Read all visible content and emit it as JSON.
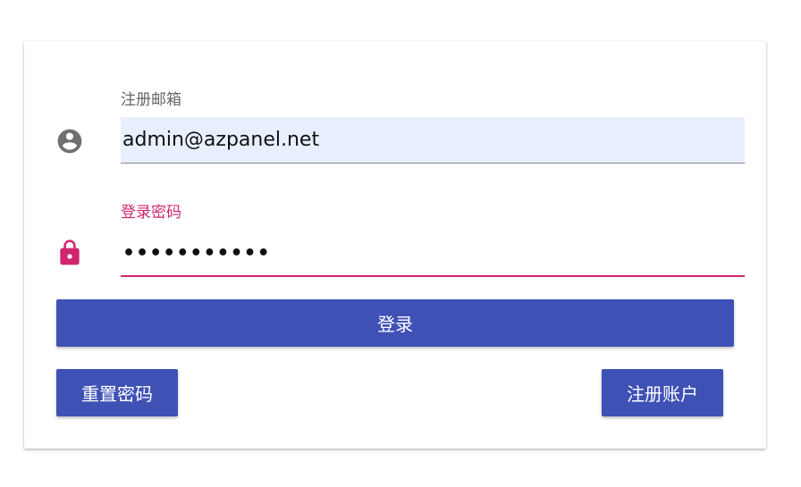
{
  "colors": {
    "primary": "#3f51b5",
    "accent": "#d0266f",
    "icon_gray": "#707070",
    "email_bg": "#e8f0fe"
  },
  "login_form": {
    "email": {
      "label": "注册邮箱",
      "value": "admin@azpanel.net",
      "icon": "account-circle-icon"
    },
    "password": {
      "label": "登录密码",
      "value": "•••••••••••",
      "icon": "lock-icon"
    },
    "login_button": "登录",
    "reset_password_button": "重置密码",
    "register_button": "注册账户"
  }
}
